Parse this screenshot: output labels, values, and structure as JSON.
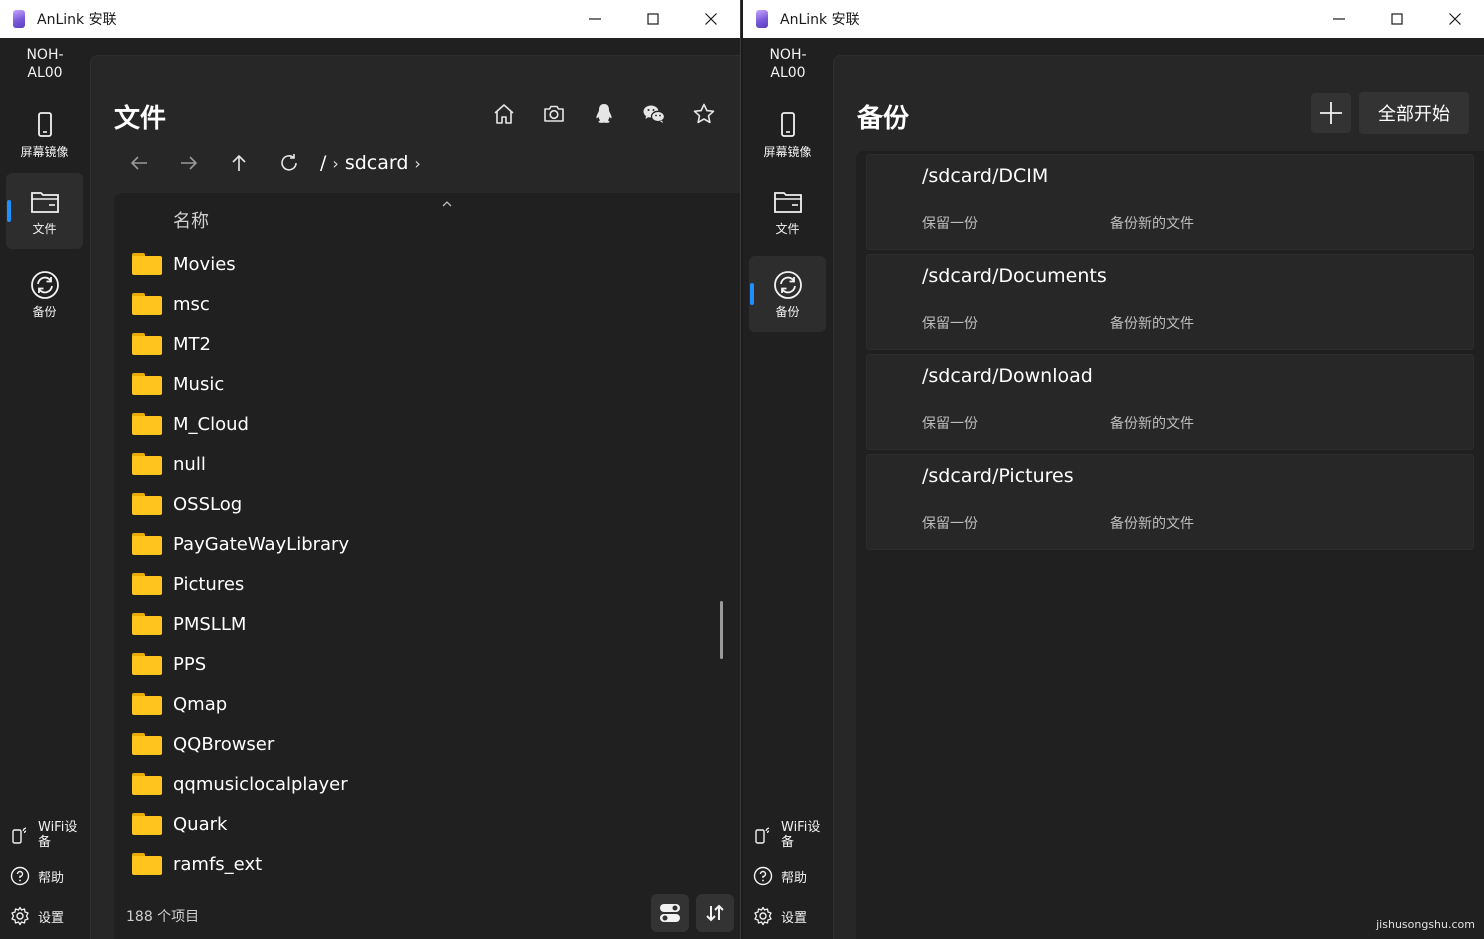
{
  "left_window": {
    "title": "AnLink 安联",
    "device_name": "NOH-\nAL00",
    "nav": {
      "mirror": "屏幕镜像",
      "files": "文件",
      "backup": "备份"
    },
    "bottom": {
      "wifi": "WiFi设备",
      "help": "帮助",
      "settings": "设置"
    },
    "page_title": "文件",
    "breadcrumb": {
      "root": "/",
      "current": "sdcard"
    },
    "column_header": "名称",
    "files": [
      "Movies",
      "msc",
      "MT2",
      "Music",
      "M_Cloud",
      "null",
      "OSSLog",
      "PayGateWayLibrary",
      "Pictures",
      "PMSLLM",
      "PPS",
      "Qmap",
      "QQBrowser",
      "qqmusiclocalplayer",
      "Quark",
      "ramfs_ext"
    ],
    "item_count": "188 个项目",
    "icons": {
      "toolbar": [
        "home-icon",
        "camera-icon",
        "qq-icon",
        "wechat-icon",
        "star-icon"
      ],
      "navigation": [
        "back-arrow-icon",
        "forward-arrow-icon",
        "up-arrow-icon",
        "refresh-icon"
      ]
    }
  },
  "right_window": {
    "title": "AnLink 安联",
    "device_name": "NOH-\nAL00",
    "nav": {
      "mirror": "屏幕镜像",
      "files": "文件",
      "backup": "备份"
    },
    "bottom": {
      "wifi": "WiFi设备",
      "help": "帮助",
      "settings": "设置"
    },
    "page_title": "备份",
    "start_all": "全部开始",
    "backups": [
      {
        "path": "/sdcard/DCIM",
        "keep": "保留一份",
        "mode": "备份新的文件"
      },
      {
        "path": "/sdcard/Documents",
        "keep": "保留一份",
        "mode": "备份新的文件"
      },
      {
        "path": "/sdcard/Download",
        "keep": "保留一份",
        "mode": "备份新的文件"
      },
      {
        "path": "/sdcard/Pictures",
        "keep": "保留一份",
        "mode": "备份新的文件"
      }
    ]
  },
  "watermark": "jishusongshu.com",
  "colors": {
    "accent": "#1e8fff",
    "folder": "#ffc51e",
    "background": "#202020",
    "panel": "#272727"
  }
}
